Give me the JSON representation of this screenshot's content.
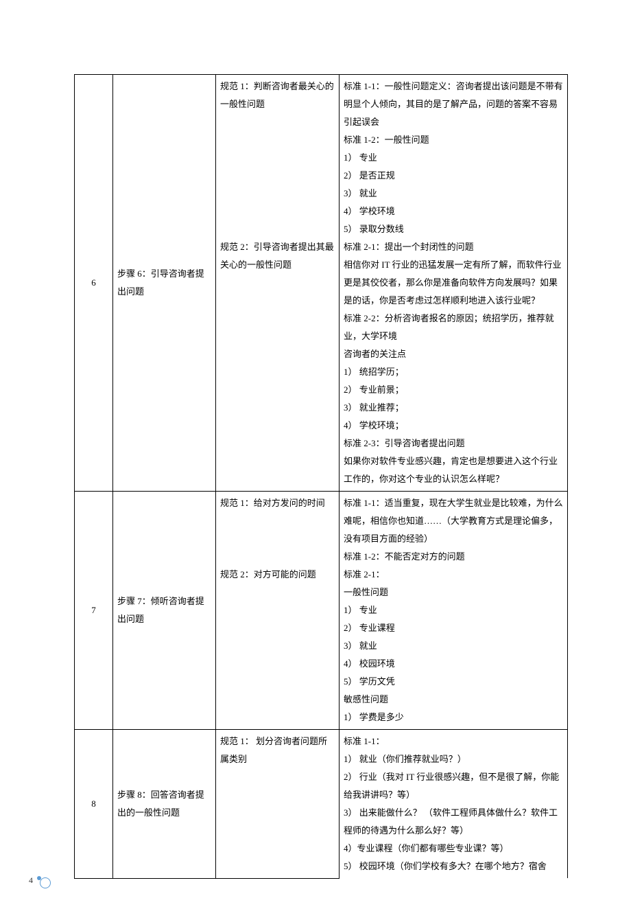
{
  "page_number": "4",
  "rows": [
    {
      "num": "6",
      "step": "步骤 6：引导咨询者提出问题",
      "spec": "规范 1：判断咨询者最关心的一般性问题\n\n\n\n\n\n\n\n规范 2：引导咨询者提出其最关心的一般性问题",
      "std": "标准 1-1：一般性问题定义：咨询者提出该问题是不带有明显个人倾向，其目的是了解产品，问题的答案不容易引起误会\n标准 1-2：一般性问题\n1）  专业\n2）  是否正规\n3）  就业\n4）  学校环境\n5）  录取分数线\n标准 2-1：提出一个封闭性的问题\n相信你对 IT 行业的迅猛发展一定有所了解，而软件行业更是其佼佼者，那么你是准备向软件方向发展吗？如果是的话，你是否考虑过怎样顺利地进入该行业呢？\n标准 2-2：分析咨询者报名的原因；统招学历，推荐就业，大学环境\n咨询者的关注点\n1）   统招学历；\n2）   专业前景；\n3）   就业推荐；\n4）   学校环境；\n标准 2-3：引导咨询者提出问题\n如果你对软件专业感兴趣，肯定也是想要进入这个行业工作的，你对这个专业的认识怎么样呢？"
    },
    {
      "num": "7",
      "step": "步骤 7：倾听咨询者提出问题",
      "spec": "规范 1：给对方发问的时间\n\n\n\n规范 2：对方可能的问题",
      "std": "标准 1-1：适当重复，现在大学生就业是比较难，为什么难呢，相信你也知道……（大学教育方式是理论偏多，没有项目方面的经验）\n标准 1-2：不能否定对方的问题\n标准 2-1：\n一般性问题\n1）  专业\n2）  专业课程\n3）  就业\n4）  校园环境\n5）  学历文凭\n敏感性问题\n1）  学费是多少"
    },
    {
      "num": "8",
      "step": "步骤 8：回答咨询者提出的一般性问题",
      "spec": "规范 1：  划分咨询者问题所属类别",
      "std": "标准 1-1：\n1）  就业（你们推荐就业吗？）\n2）  行业（我对 IT 行业很感兴趣，但不是很了解，你能给我讲讲吗？等）\n3）  出来能做什么？ （软件工程师具体做什么？软件工程师的待遇为什么那么好？等）\n4）专业课程（你们都有哪些专业课？等）\n5）  校园环境（你们学校有多大？在哪个地方？宿舍"
    }
  ]
}
